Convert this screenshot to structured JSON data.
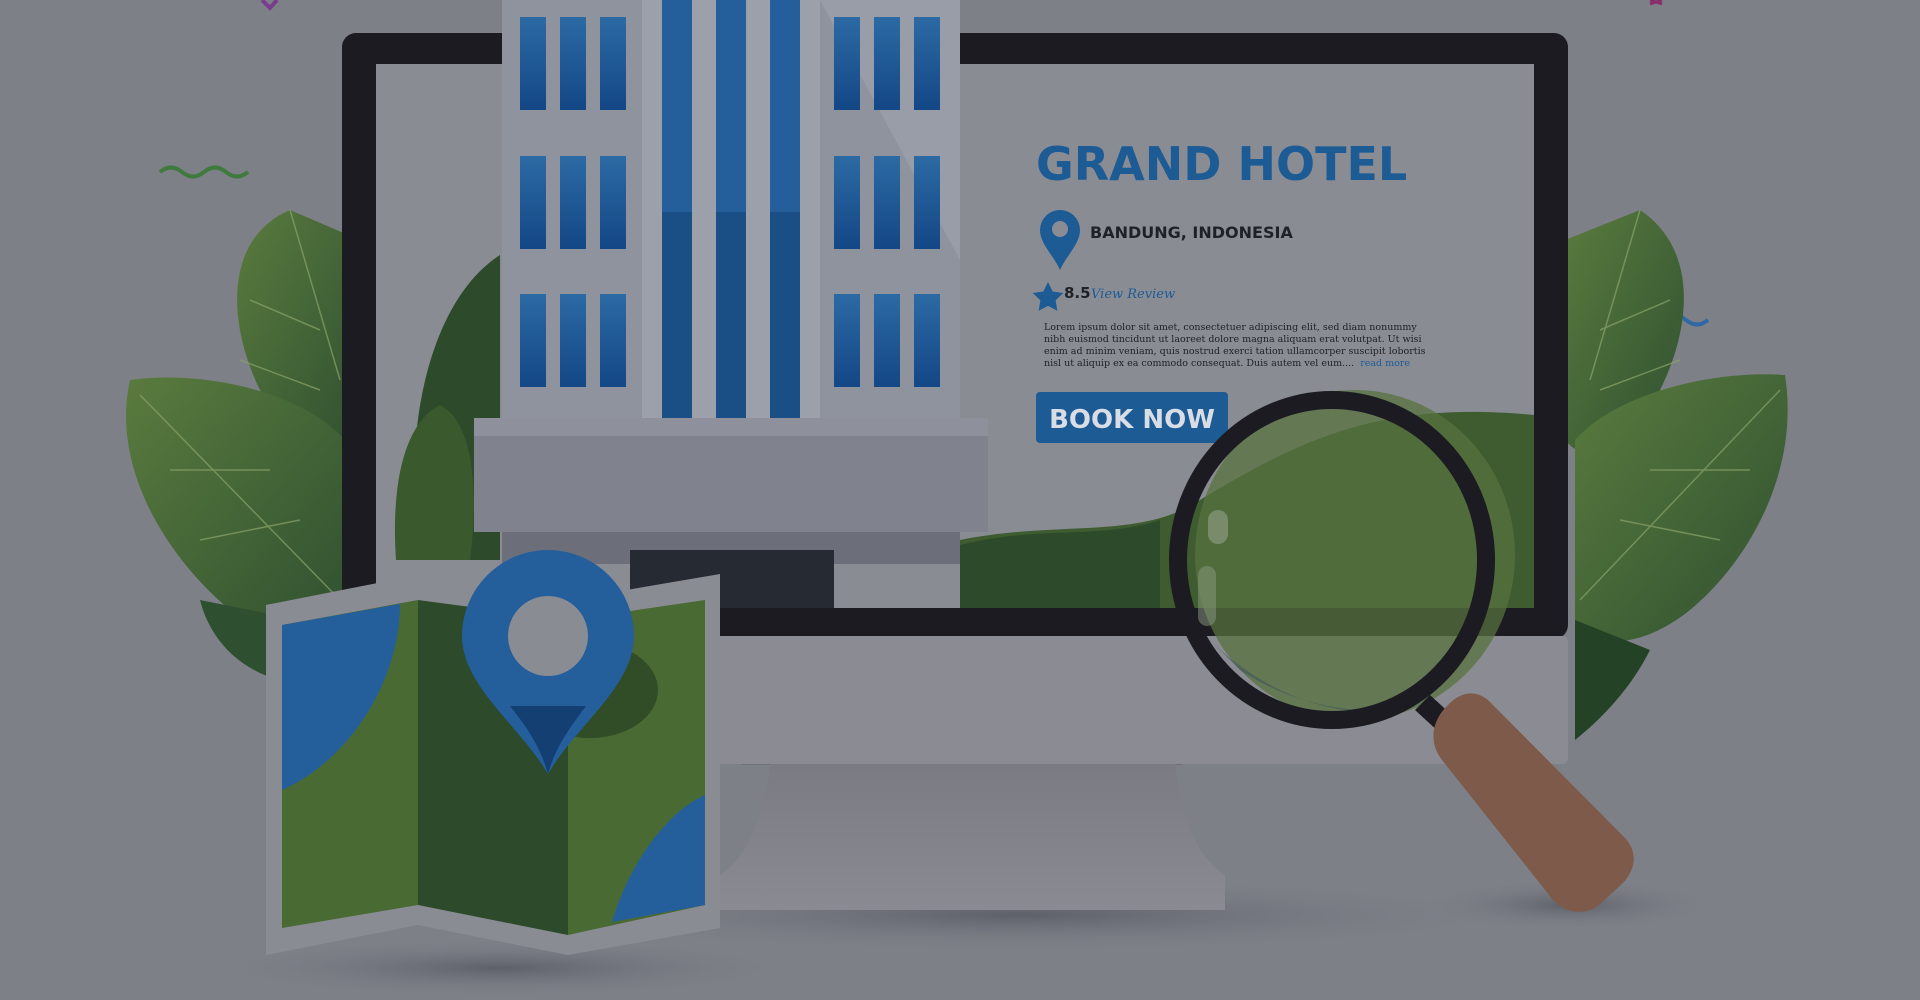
{
  "hotel": {
    "name": "GRAND HOTEL",
    "location": "BANDUNG, INDONESIA",
    "rating": "8.5",
    "review_link": "View Review",
    "description_lines": [
      "Lorem ipsum dolor sit amet, consectetuer adipiscing elit, sed diam nonummy",
      "nibh euismod tincidunt ut laoreet dolore magna aliquam erat volutpat. Ut wisi",
      "enim ad minim veniam, quis nostrud exerci tation ullamcorper suscipit lobortis",
      "nisl ut aliquip ex ea commodo consequat. Duis autem vel eum...."
    ],
    "read_more": "read more",
    "book_button": "BOOK NOW"
  },
  "icons": {
    "location_pin": "location-pin-icon",
    "rating_star": "star-icon",
    "map": "map-icon",
    "map_pin": "map-pin-icon",
    "magnifier": "magnifying-glass-icon"
  },
  "colors": {
    "backdrop": "#7e8088",
    "brand_blue": "#1a5c96",
    "monitor_frame": "#1c1b22",
    "leaf_green": "#4a6a34",
    "dark_green": "#2d4a2b",
    "handle_brown": "#7d5a4a"
  }
}
